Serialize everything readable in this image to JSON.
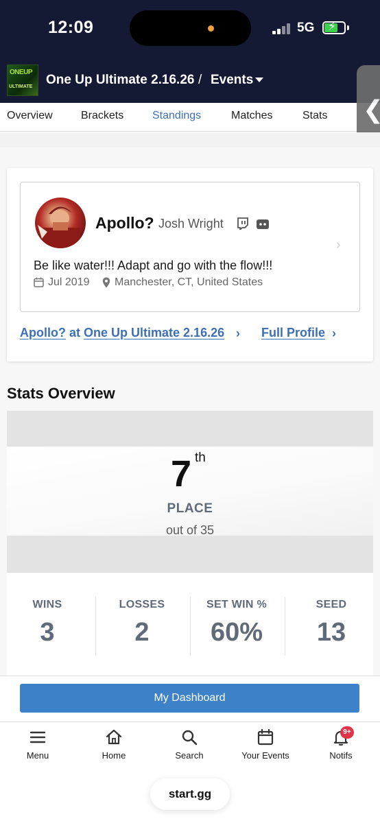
{
  "status_bar": {
    "time": "12:09",
    "network": "5G"
  },
  "header": {
    "event_title": "One Up Ultimate 2.16.26",
    "separator": "/",
    "events_dropdown": "Events",
    "logo_text_line1": "ONEUP",
    "logo_text_line2": "ULTIMATE"
  },
  "tabs": [
    {
      "label": "Overview",
      "active": false
    },
    {
      "label": "Brackets",
      "active": false
    },
    {
      "label": "Standings",
      "active": true
    },
    {
      "label": "Matches",
      "active": false
    },
    {
      "label": "Stats",
      "active": false
    }
  ],
  "side_handle": "❮",
  "profile": {
    "gamer_tag": "Apollo?",
    "real_name": "Josh Wright",
    "bio": "Be like water!!! Adapt and go with the flow!!!",
    "joined": "Jul 2019",
    "location": "Manchester, CT, United States",
    "link_event_prefix": "Apollo?",
    "link_event_at": "at",
    "link_event_name": "One Up Ultimate 2.16.26",
    "link_full_profile": "Full Profile",
    "chevron": "›"
  },
  "stats": {
    "title": "Stats Overview",
    "placement": "7",
    "placement_suffix": "th",
    "placement_label": "PLACE",
    "out_of": "out of 35",
    "items": [
      {
        "label": "WINS",
        "value": "3"
      },
      {
        "label": "LOSSES",
        "value": "2"
      },
      {
        "label": "SET WIN %",
        "value": "60%"
      },
      {
        "label": "SEED",
        "value": "13"
      }
    ]
  },
  "dashboard_button": "My Dashboard",
  "bottom_nav": [
    {
      "label": "Menu",
      "icon": "menu-icon"
    },
    {
      "label": "Home",
      "icon": "home-icon"
    },
    {
      "label": "Search",
      "icon": "search-icon"
    },
    {
      "label": "Your Events",
      "icon": "calendar-icon"
    },
    {
      "label": "Notifs",
      "icon": "bell-icon"
    }
  ],
  "notif_badge": "9+",
  "browser_url": "start.gg",
  "colors": {
    "header_bg": "#141a33",
    "link_blue": "#3d6fb5",
    "button_blue": "#3d82c8",
    "badge_red": "#e0344a"
  }
}
